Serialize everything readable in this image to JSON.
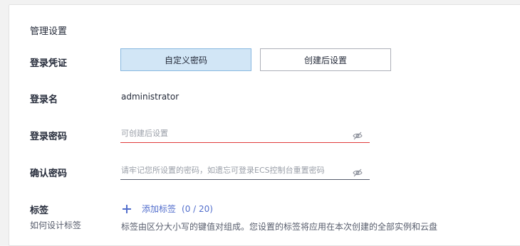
{
  "section": {
    "title": "管理设置"
  },
  "credential": {
    "label": "登录凭证",
    "options": [
      {
        "label": "自定义密码",
        "selected": true
      },
      {
        "label": "创建后设置",
        "selected": false
      }
    ]
  },
  "login_name": {
    "label": "登录名",
    "value": "administrator"
  },
  "password": {
    "label": "登录密码",
    "placeholder": "可创建后设置",
    "icon": "eye-off-icon"
  },
  "confirm_password": {
    "label": "确认密码",
    "placeholder": "请牢记您所设置的密码，如遗忘可登录ECS控制台重置密码",
    "icon": "eye-off-icon"
  },
  "tags": {
    "label": "标签",
    "help_link": "如何设计标签",
    "add_label": "添加标签",
    "count": "(0 / 20)",
    "hint": "标签由区分大小写的键值对组成。您设置的标签将应用在本次创建的全部实例和云盘"
  },
  "colors": {
    "accent": "#526ecc",
    "selected_bg": "#d2e6f6",
    "error": "#e03c3c"
  }
}
